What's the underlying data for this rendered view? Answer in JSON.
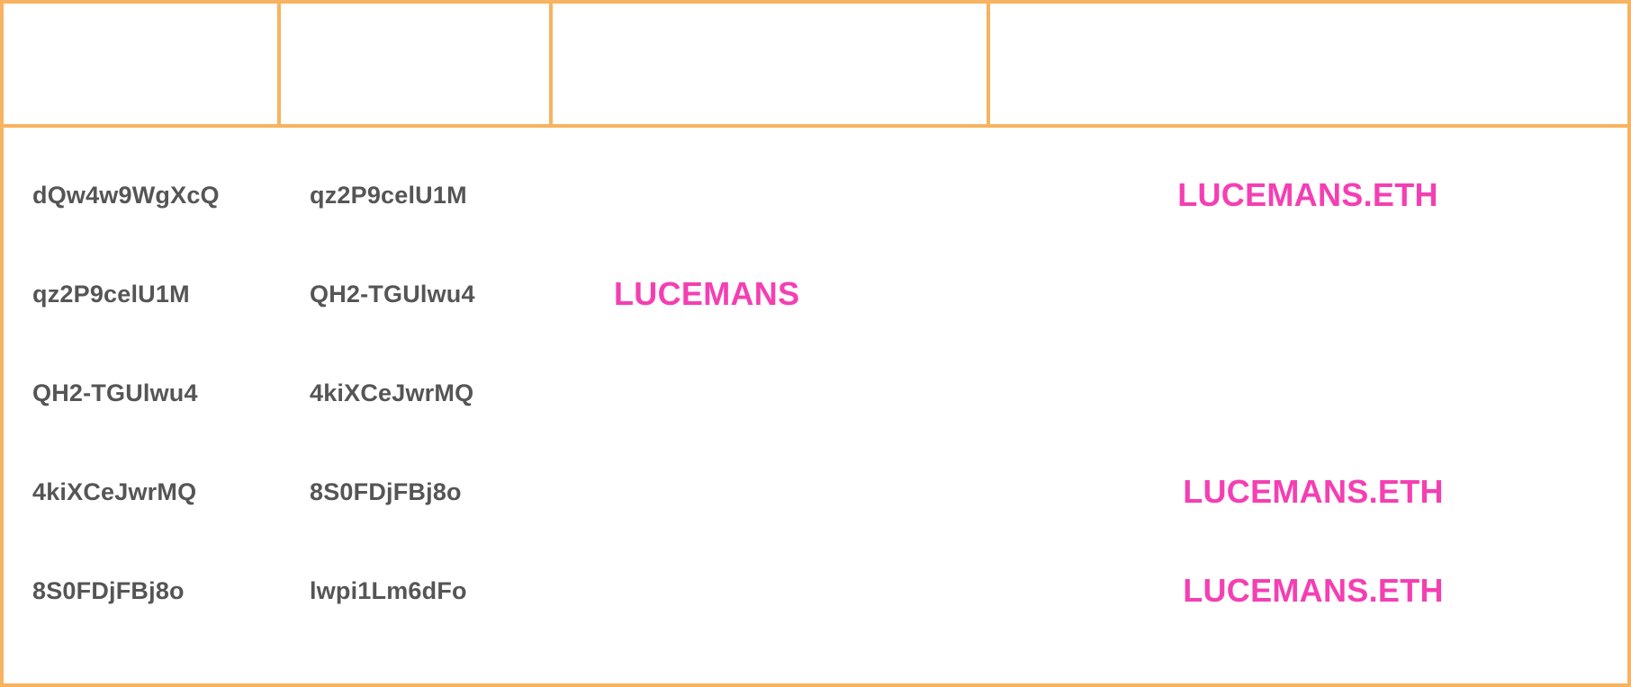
{
  "columns": [
    "",
    "",
    "",
    ""
  ],
  "rows": [
    {
      "col1": "dQw4w9WgXcQ",
      "col2": "qz2P9celU1M",
      "col3": "",
      "col4": "LUCEMANS.ETH"
    },
    {
      "col1": "qz2P9celU1M",
      "col2": "QH2-TGUlwu4",
      "col3": "LUCEMANS",
      "col4": ""
    },
    {
      "col1": "QH2-TGUlwu4",
      "col2": "4kiXCeJwrMQ",
      "col3": "",
      "col4": ""
    },
    {
      "col1": "4kiXCeJwrMQ",
      "col2": "8S0FDjFBj8o",
      "col3": "",
      "col4": "LUCEMANS.ETH"
    },
    {
      "col1": "8S0FDjFBj8o",
      "col2": "lwpi1Lm6dFo",
      "col3": "",
      "col4": "LUCEMANS.ETH"
    }
  ],
  "colors": {
    "border": "#f7b35f",
    "id_text": "#555555",
    "tag_text": "#f43fb3"
  }
}
